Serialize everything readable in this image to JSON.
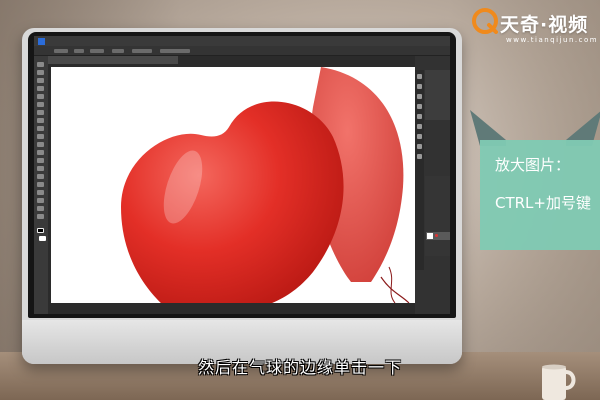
{
  "logo": {
    "brand": "天奇·视频",
    "url": "www.tianqijun.com"
  },
  "card": {
    "line1": "放大图片：",
    "line2": "CTRL+加号键"
  },
  "subtitle": "然后在气球的边缘单击一下",
  "colors": {
    "card": "#7fcab3",
    "card_fold": "#607a78",
    "logo_orange": "#f08a1c",
    "balloon_red": "#e8322a",
    "ps_dark": "#2b2b2b"
  },
  "icons": [
    "tianqi-logo-icon",
    "photoshop-icon",
    "coffee-mug-icon"
  ]
}
